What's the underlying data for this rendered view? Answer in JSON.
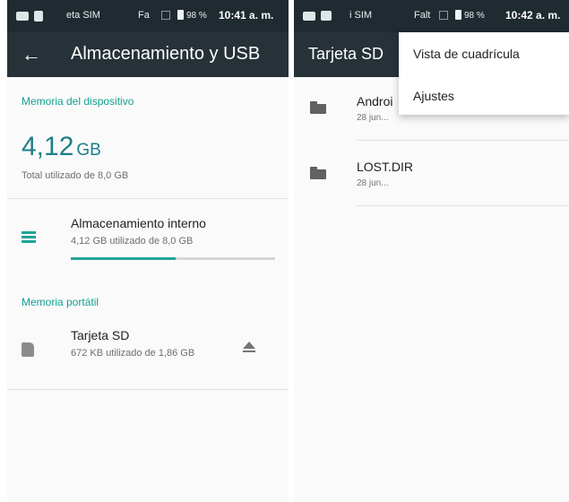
{
  "left_screen": {
    "status": {
      "carrier": "eta SIM",
      "network": "Fa",
      "battery": "98 %",
      "time": "10:41 a. m."
    },
    "appbar": {
      "back_icon": "arrow-left-icon",
      "title": "Almacenamiento y USB"
    },
    "device_memory": {
      "section_title": "Memoria del dispositivo",
      "used_value": "4,12",
      "used_unit": "GB",
      "total_text": "Total utilizado de 8,0 GB"
    },
    "internal_storage": {
      "icon": "storage-list-icon",
      "title": "Almacenamiento interno",
      "subtitle": "4,12 GB utilizado de 8,0 GB",
      "usage_fraction": 0.515,
      "accent_color": "#1fa597"
    },
    "portable_memory": {
      "section_title": "Memoria portátil",
      "sd_card": {
        "icon": "sd-card-icon",
        "title": "Tarjeta SD",
        "subtitle": "672 KB utilizado de 1,86 GB",
        "eject_icon": "eject-icon"
      }
    }
  },
  "right_screen": {
    "status": {
      "carrier": "i SIM",
      "network": "Falt",
      "battery": "98 %",
      "time": "10:42 a. m."
    },
    "appbar": {
      "title": "Tarjeta SD"
    },
    "files": [
      {
        "icon": "folder-icon",
        "name": "Androi",
        "date": "28 jun..."
      },
      {
        "icon": "folder-icon",
        "name": "LOST.DIR",
        "date": "28 jun..."
      }
    ],
    "overflow_menu": {
      "items": [
        {
          "label": "Vista de cuadrícula"
        },
        {
          "label": "Ajustes"
        }
      ]
    }
  }
}
